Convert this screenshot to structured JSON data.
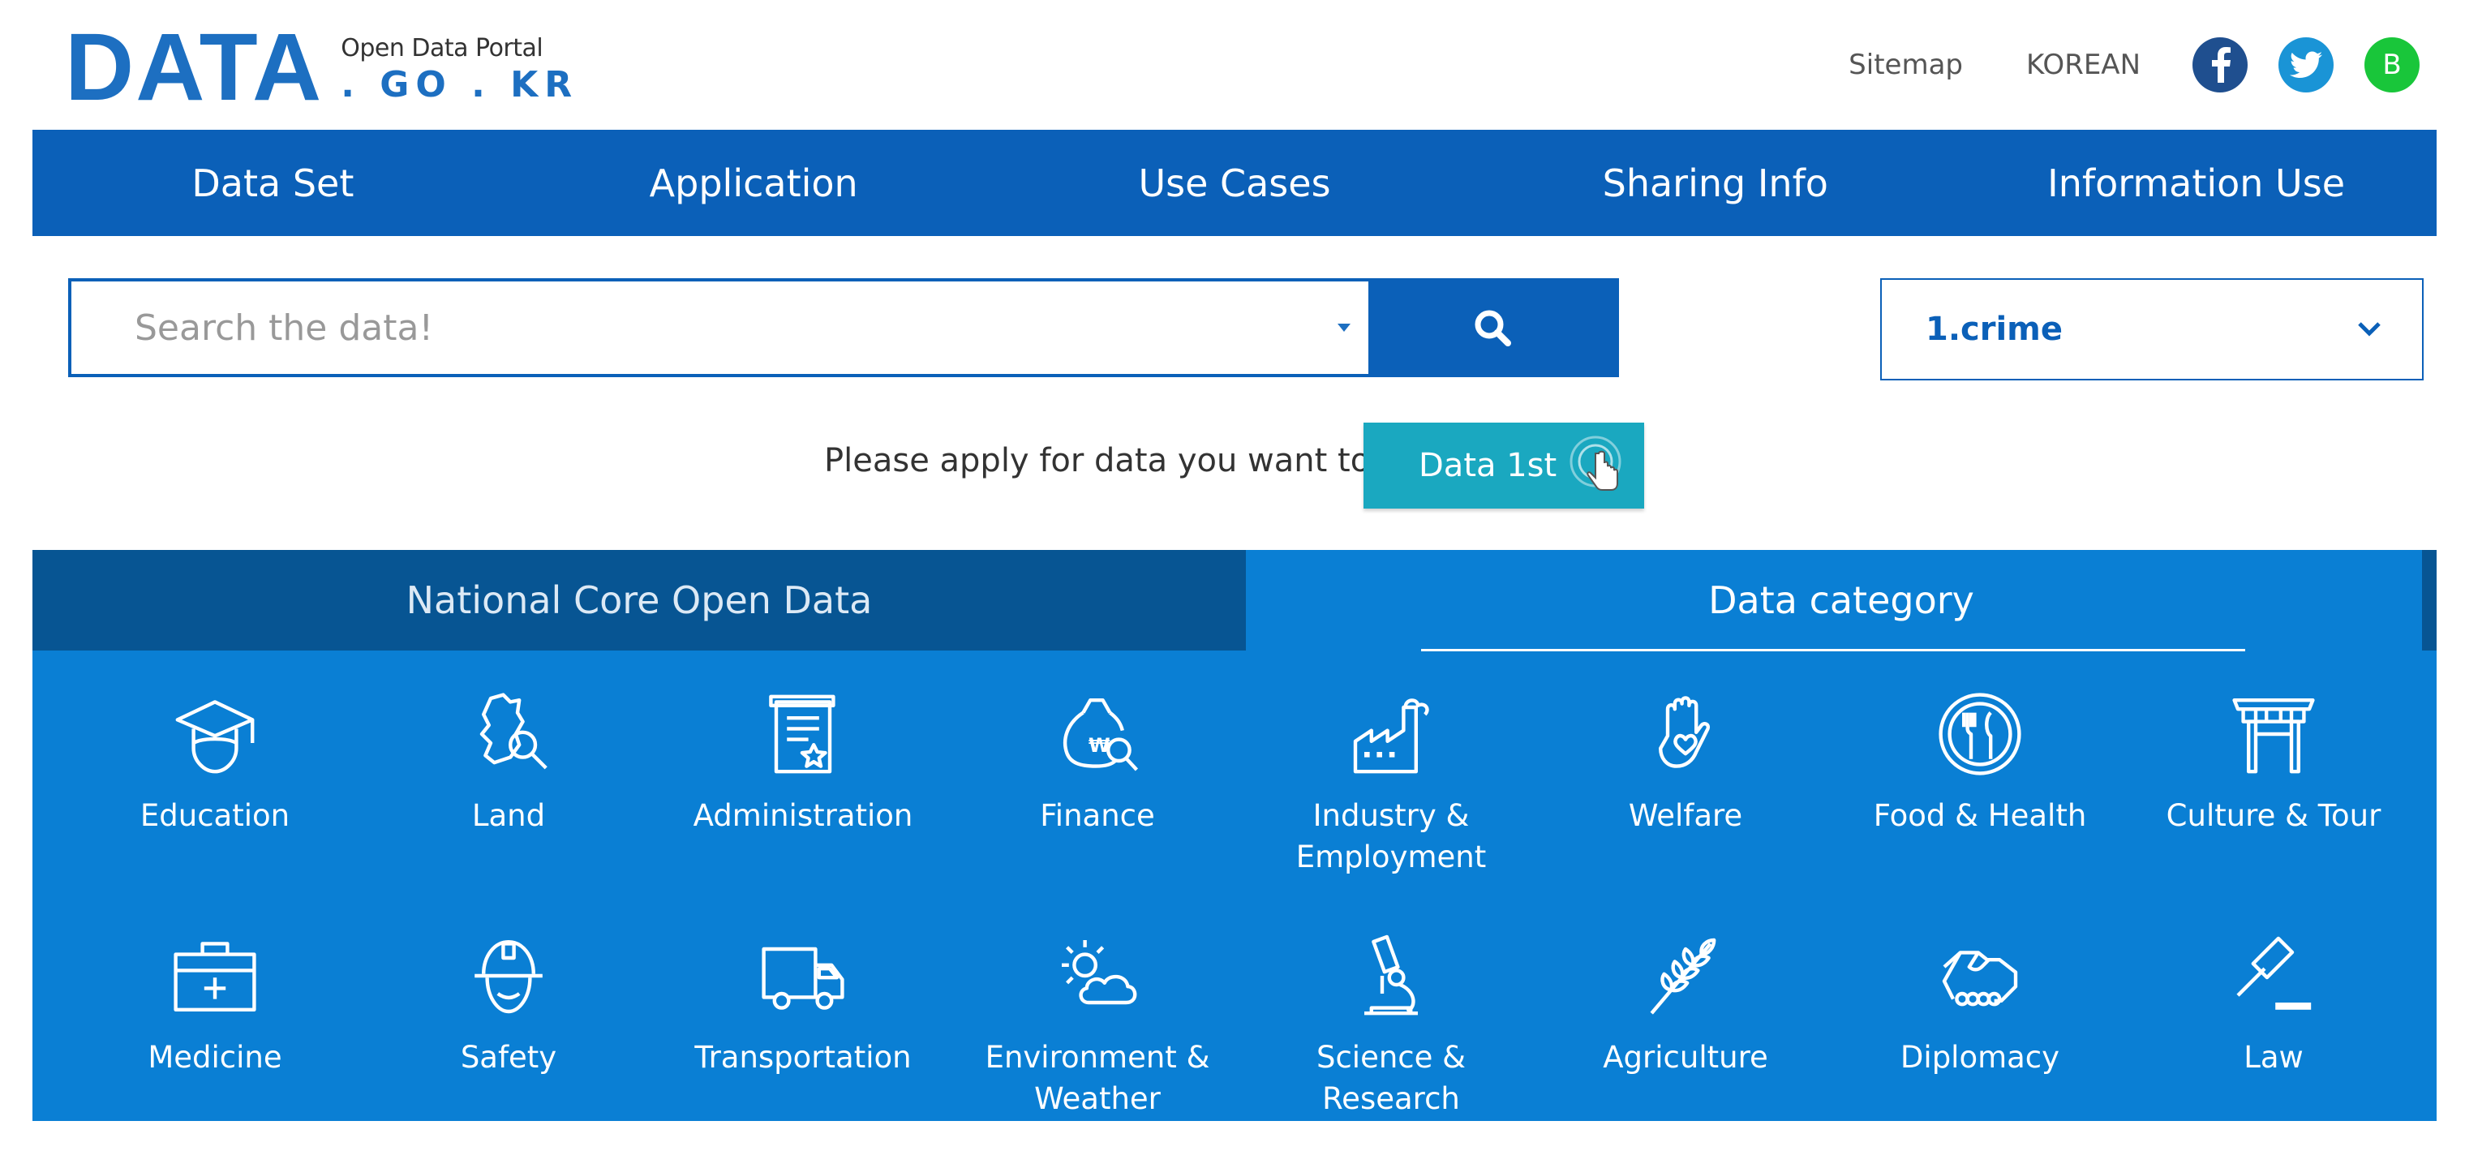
{
  "logo": {
    "main": "DATA",
    "sub": "Open Data Portal",
    "domain": ". GO . KR"
  },
  "util": {
    "sitemap": "Sitemap",
    "language": "KOREAN",
    "blog_letter": "B"
  },
  "nav": [
    "Data Set",
    "Application",
    "Use Cases",
    "Sharing Info",
    "Information Use"
  ],
  "search": {
    "placeholder": "Search the data!",
    "value": ""
  },
  "select": {
    "value": "1.crime"
  },
  "apply": {
    "text": "Please apply for data you want to",
    "button": "Data 1st"
  },
  "tabs": {
    "left": "National Core Open Data",
    "right": "Data category",
    "active": "right"
  },
  "categories": [
    {
      "label": "Education",
      "icon": "graduation-cap-icon"
    },
    {
      "label": "Land",
      "icon": "map-search-icon"
    },
    {
      "label": "Administration",
      "icon": "certificate-icon"
    },
    {
      "label": "Finance",
      "icon": "money-bag-icon"
    },
    {
      "label": "Industry & Employment",
      "icon": "factory-icon"
    },
    {
      "label": "Welfare",
      "icon": "hand-heart-icon"
    },
    {
      "label": "Food & Health",
      "icon": "plate-cutlery-icon"
    },
    {
      "label": "Culture & Tour",
      "icon": "gate-icon"
    },
    {
      "label": "Medicine",
      "icon": "medical-kit-icon"
    },
    {
      "label": "Safety",
      "icon": "helmet-icon"
    },
    {
      "label": "Transportation",
      "icon": "truck-icon"
    },
    {
      "label": "Environment & Weather",
      "icon": "sun-cloud-icon"
    },
    {
      "label": "Science & Research",
      "icon": "microscope-icon"
    },
    {
      "label": "Agriculture",
      "icon": "wheat-icon"
    },
    {
      "label": "Diplomacy",
      "icon": "handshake-icon"
    },
    {
      "label": "Law",
      "icon": "gavel-icon"
    }
  ],
  "colors": {
    "primary": "#0b60b8",
    "panel": "#0a7fd4",
    "panel_dark": "#075593",
    "accent": "#1aa8c0",
    "facebook": "#1f4f8f",
    "twitter": "#1a94d6",
    "blog": "#19c63a"
  }
}
